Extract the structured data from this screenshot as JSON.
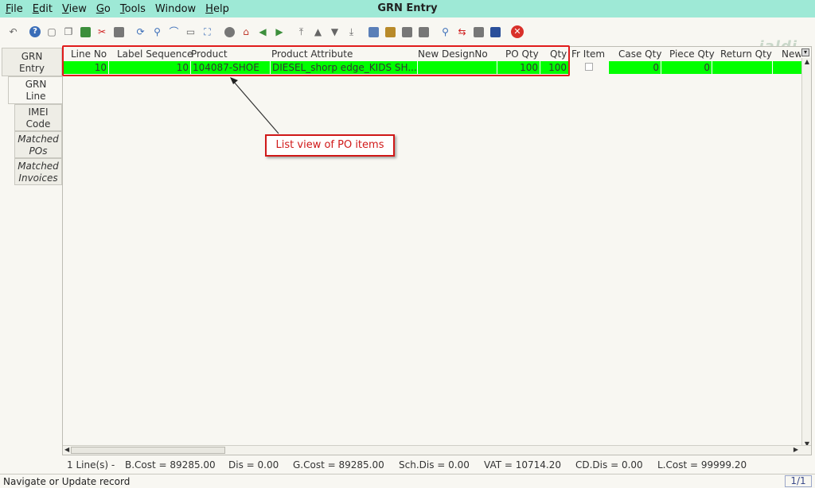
{
  "window": {
    "title": "GRN Entry"
  },
  "menu": [
    {
      "label": "File",
      "mn": "F",
      "rest": "ile"
    },
    {
      "label": "Edit",
      "mn": "E",
      "rest": "dit"
    },
    {
      "label": "View",
      "mn": "V",
      "rest": "iew"
    },
    {
      "label": "Go",
      "mn": "G",
      "rest": "o"
    },
    {
      "label": "Tools",
      "mn": "T",
      "rest": "ools"
    },
    {
      "label": "Window",
      "mn": "",
      "rest": "Window"
    },
    {
      "label": "Help",
      "mn": "H",
      "rest": "elp"
    }
  ],
  "toolbar": {
    "icons": [
      "undo-icon",
      "help-icon",
      "new-icon",
      "copy-icon",
      "save-icon",
      "delete-icon",
      "print-icon",
      "refresh-icon",
      "find-icon",
      "attach-icon",
      "chat-icon",
      "fullscreen-icon",
      "history-icon",
      "home-icon",
      "back-icon",
      "forward-icon",
      "first-record-icon",
      "previous-record-icon",
      "next-record-icon",
      "last-record-icon",
      "report-icon",
      "archive-icon",
      "print-preview-icon",
      "export-icon",
      "zoom-icon",
      "workflow-icon",
      "process-icon",
      "request-icon",
      "close-icon"
    ],
    "logo": "jaldi"
  },
  "tabs": [
    {
      "line1": "GRN",
      "line2": "Entry",
      "italic": false
    },
    {
      "line1": "GRN",
      "line2": "Line",
      "italic": false
    },
    {
      "line1": "IMEI",
      "line2": "Code",
      "italic": false
    },
    {
      "line1": "Matched",
      "line2": "POs",
      "italic": true
    },
    {
      "line1": "Matched",
      "line2": "Invoices",
      "italic": true
    }
  ],
  "grid": {
    "columns": [
      "Line No",
      "Label Sequence",
      "Product",
      "Product Attribute",
      "New DesignNo",
      "PO Qty",
      "Qty",
      "Fr Item",
      "Case Qty",
      "Piece Qty",
      "Return Qty",
      "New"
    ],
    "rows": [
      {
        "line_no": "10",
        "label_sequence": "10",
        "product": "104087-SHOE",
        "product_attribute": "DIESEL_shorp edge_KIDS SH...",
        "new_design_no": "",
        "po_qty": "100",
        "qty": "100",
        "fr_item": false,
        "case_qty": "0",
        "piece_qty": "0",
        "return_qty": "",
        "new": ""
      }
    ]
  },
  "annotation": {
    "callout": "List view of PO items"
  },
  "summary": {
    "lines": "1 Line(s) -",
    "b_cost": "B.Cost = 89285.00",
    "dis": "Dis = 0.00",
    "g_cost": "G.Cost = 89285.00",
    "sch_dis": "Sch.Dis = 0.00",
    "vat": "VAT = 10714.20",
    "cd_dis": "CD.Dis = 0.00",
    "l_cost": "L.Cost = 99999.20"
  },
  "status": {
    "text": "Navigate or Update record",
    "page": "1/1"
  }
}
